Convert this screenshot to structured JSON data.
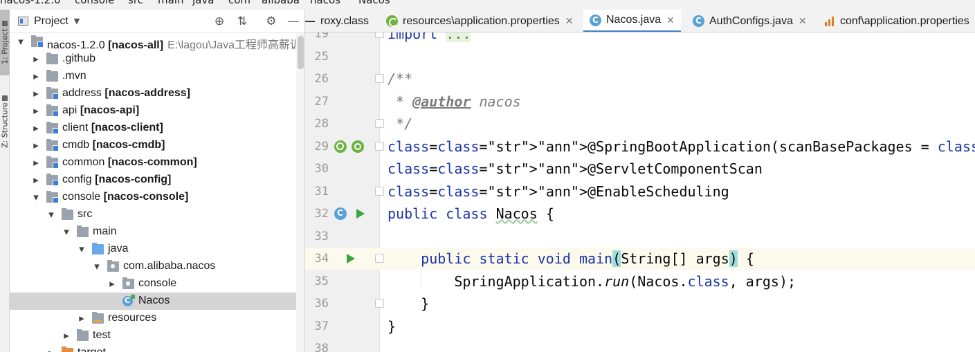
{
  "breadcrumb": [
    "nacos-1.2.0",
    "console",
    "src",
    "main",
    "java",
    "com",
    "alibaba",
    "nacos",
    "Nacos"
  ],
  "tool_stripe": {
    "project_label": "1: Project",
    "structure_label": "Z: Structure"
  },
  "project_panel": {
    "title": "Project",
    "tree": [
      {
        "indent": 0,
        "expanded": true,
        "icon": "module-folder",
        "name": "nacos-1.2.0",
        "bold": "[nacos-all]",
        "path": "E:\\lagou\\Java工程师高薪训练"
      },
      {
        "indent": 1,
        "expanded": false,
        "icon": "folder",
        "name": ".github",
        "bold": ""
      },
      {
        "indent": 1,
        "expanded": false,
        "icon": "folder",
        "name": ".mvn",
        "bold": ""
      },
      {
        "indent": 1,
        "expanded": false,
        "icon": "module-folder",
        "name": "address",
        "bold": "[nacos-address]"
      },
      {
        "indent": 1,
        "expanded": false,
        "icon": "module-folder",
        "name": "api",
        "bold": "[nacos-api]"
      },
      {
        "indent": 1,
        "expanded": false,
        "icon": "module-folder",
        "name": "client",
        "bold": "[nacos-client]"
      },
      {
        "indent": 1,
        "expanded": false,
        "icon": "module-folder",
        "name": "cmdb",
        "bold": "[nacos-cmdb]"
      },
      {
        "indent": 1,
        "expanded": false,
        "icon": "module-folder",
        "name": "common",
        "bold": "[nacos-common]"
      },
      {
        "indent": 1,
        "expanded": false,
        "icon": "module-folder",
        "name": "config",
        "bold": "[nacos-config]"
      },
      {
        "indent": 1,
        "expanded": true,
        "icon": "module-folder",
        "name": "console",
        "bold": "[nacos-console]"
      },
      {
        "indent": 2,
        "expanded": true,
        "icon": "folder",
        "name": "src",
        "bold": ""
      },
      {
        "indent": 3,
        "expanded": true,
        "icon": "folder",
        "name": "main",
        "bold": ""
      },
      {
        "indent": 4,
        "expanded": true,
        "icon": "source-folder",
        "name": "java",
        "bold": ""
      },
      {
        "indent": 5,
        "expanded": true,
        "icon": "package",
        "name": "com.alibaba.nacos",
        "bold": ""
      },
      {
        "indent": 6,
        "expanded": false,
        "icon": "package",
        "name": "console",
        "bold": ""
      },
      {
        "indent": 6,
        "expanded": null,
        "icon": "class",
        "name": "Nacos",
        "bold": "",
        "selected": true
      },
      {
        "indent": 4,
        "expanded": false,
        "icon": "resources-folder",
        "name": "resources",
        "bold": ""
      },
      {
        "indent": 3,
        "expanded": false,
        "icon": "folder",
        "name": "test",
        "bold": ""
      },
      {
        "indent": 2,
        "expanded": false,
        "icon": "orange-folder",
        "name": "target",
        "bold": ""
      }
    ]
  },
  "tabs": [
    {
      "label": "roxy.class",
      "icon": "dash",
      "closable": false,
      "active": false
    },
    {
      "label": "resources\\application.properties",
      "icon": "spring",
      "closable": true,
      "active": false
    },
    {
      "label": "Nacos.java",
      "icon": "class",
      "closable": true,
      "active": true
    },
    {
      "label": "AuthConfigs.java",
      "icon": "class",
      "closable": true,
      "active": false
    },
    {
      "label": "conf\\application.properties",
      "icon": "properties",
      "closable": false,
      "active": false
    }
  ],
  "editor": {
    "lines": [
      {
        "n": "19",
        "text": "import ..."
      },
      {
        "n": "25",
        "text": ""
      },
      {
        "n": "26",
        "text": "/**"
      },
      {
        "n": "27",
        "text": " * @author nacos"
      },
      {
        "n": "28",
        "text": " */"
      },
      {
        "n": "29",
        "text": "@SpringBootApplication(scanBasePackages = \"com.alibaba.nacos\")"
      },
      {
        "n": "30",
        "text": "@ServletComponentScan"
      },
      {
        "n": "31",
        "text": "@EnableScheduling"
      },
      {
        "n": "32",
        "text": "public class Nacos {"
      },
      {
        "n": "33",
        "text": ""
      },
      {
        "n": "34",
        "text": "    public static void main(String[] args) {"
      },
      {
        "n": "35",
        "text": "        SpringApplication.run(Nacos.class, args);"
      },
      {
        "n": "36",
        "text": "    }"
      },
      {
        "n": "37",
        "text": "}"
      },
      {
        "n": "38",
        "text": ""
      }
    ],
    "current_line": "34"
  }
}
